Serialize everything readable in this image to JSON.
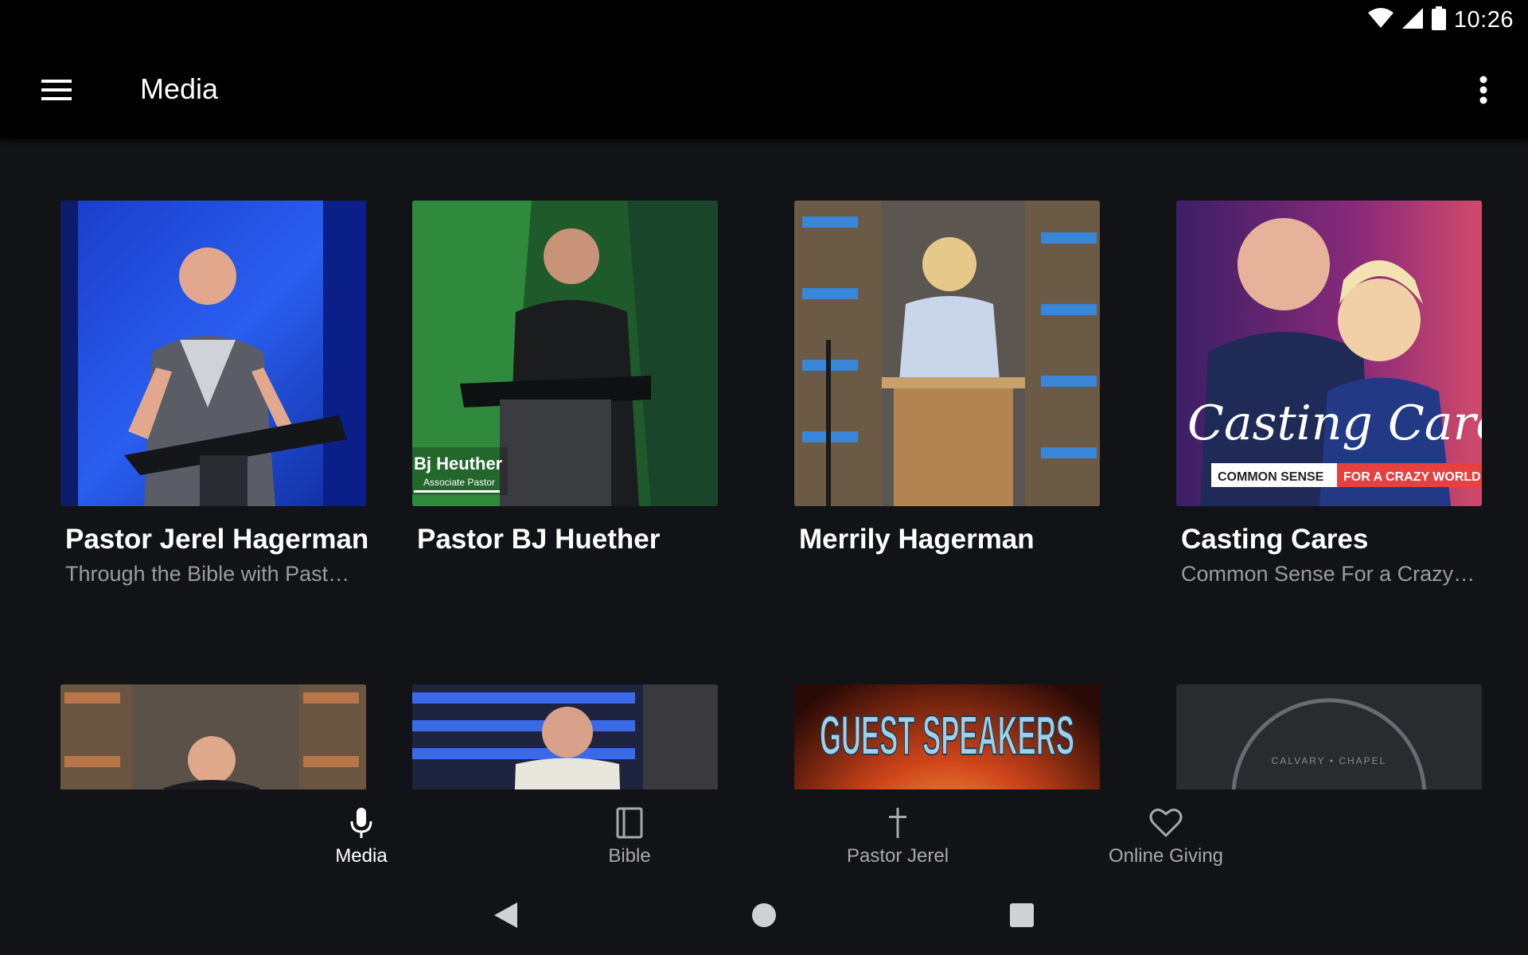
{
  "status_bar": {
    "time": "10:26",
    "icons": [
      "wifi-icon",
      "cell-signal-icon",
      "battery-icon"
    ]
  },
  "app_bar": {
    "title": "Media",
    "menu_icon": "hamburger-menu-icon",
    "overflow_icon": "more-vert-icon"
  },
  "cards": [
    {
      "title": "Pastor Jerel Hagerman",
      "subtitle": "Through the Bible with Past…"
    },
    {
      "title": "Pastor BJ Huether",
      "subtitle": "",
      "overlay_name": "Bj Heuther",
      "overlay_role": "Associate Pastor"
    },
    {
      "title": "Merrily Hagerman",
      "subtitle": ""
    },
    {
      "title": "Casting Cares",
      "subtitle": "Common Sense For a Crazy…",
      "art_script": "Casting Cares",
      "art_left": "COMMON SENSE",
      "art_right": "FOR A CRAZY WORLD"
    },
    {
      "title": "",
      "subtitle": ""
    },
    {
      "title": "",
      "subtitle": ""
    },
    {
      "title": "",
      "subtitle": "",
      "art_text": "GUEST SPEAKERS"
    },
    {
      "title": "",
      "subtitle": "",
      "art_text": "CALVARY • CHAPEL"
    }
  ],
  "bottom_nav": [
    {
      "label": "Media",
      "icon": "microphone-icon",
      "active": true
    },
    {
      "label": "Bible",
      "icon": "book-icon",
      "active": false
    },
    {
      "label": "Pastor Jerel",
      "icon": "cross-icon",
      "active": false
    },
    {
      "label": "Online Giving",
      "icon": "heart-icon",
      "active": false
    }
  ],
  "system_nav": {
    "back_icon": "back-triangle-icon",
    "home_icon": "home-circle-icon",
    "recents_icon": "recents-square-icon"
  },
  "colors": {
    "background": "#121316",
    "appbar": "#000000",
    "subtitle": "#9a9ca0",
    "accent_red": "#e8403e"
  }
}
